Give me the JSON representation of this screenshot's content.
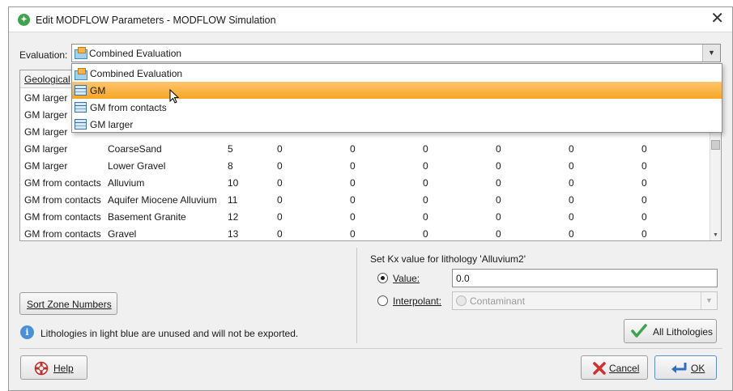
{
  "window": {
    "title": "Edit MODFLOW Parameters - MODFLOW Simulation"
  },
  "evaluation": {
    "label": "Evaluation:",
    "selected": "Combined Evaluation",
    "options": [
      "Combined Evaluation",
      "GM",
      "GM from contacts",
      "GM larger"
    ],
    "highlighted_index": 1
  },
  "table": {
    "columns": [
      "Geological"
    ],
    "rows": [
      {
        "model": "GM larger",
        "lithology": "",
        "zone": "",
        "values": []
      },
      {
        "model": "GM larger",
        "lithology": "",
        "zone": "",
        "values": []
      },
      {
        "model": "GM larger",
        "lithology": "",
        "zone": "",
        "values": []
      },
      {
        "model": "GM larger",
        "lithology": "CoarseSand",
        "zone": "5",
        "values": [
          "0",
          "0",
          "0",
          "0",
          "0",
          "0"
        ]
      },
      {
        "model": "GM larger",
        "lithology": "Lower Gravel",
        "zone": "8",
        "values": [
          "0",
          "0",
          "0",
          "0",
          "0",
          "0"
        ]
      },
      {
        "model": "GM from contacts",
        "lithology": "Alluvium",
        "zone": "10",
        "values": [
          "0",
          "0",
          "0",
          "0",
          "0",
          "0"
        ]
      },
      {
        "model": "GM from contacts",
        "lithology": "Aquifer Miocene Alluvium",
        "zone": "11",
        "values": [
          "0",
          "0",
          "0",
          "0",
          "0",
          "0"
        ]
      },
      {
        "model": "GM from contacts",
        "lithology": "Basement Granite",
        "zone": "12",
        "values": [
          "0",
          "0",
          "0",
          "0",
          "0",
          "0"
        ]
      },
      {
        "model": "GM from contacts",
        "lithology": "Gravel",
        "zone": "13",
        "values": [
          "0",
          "0",
          "0",
          "0",
          "0",
          "0"
        ]
      }
    ]
  },
  "kx_panel": {
    "heading": "Set Kx value for lithology 'Alluvium2'",
    "value_label": "Value:",
    "value": "0.0",
    "interpolant_label": "Interpolant:",
    "interpolant_value": "Contaminant",
    "all_lithologies_label": "All Lithologies"
  },
  "sort_zone_label": "Sort Zone Numbers",
  "info_text": "Lithologies in light blue are unused and will not be exported.",
  "buttons": {
    "help": "Help",
    "cancel": "Cancel",
    "ok": "OK"
  },
  "colors": {
    "selection": "#f5a623",
    "info": "#4a90d9",
    "cancel_icon": "#d32f2f",
    "check_icon": "#3fa34d"
  }
}
